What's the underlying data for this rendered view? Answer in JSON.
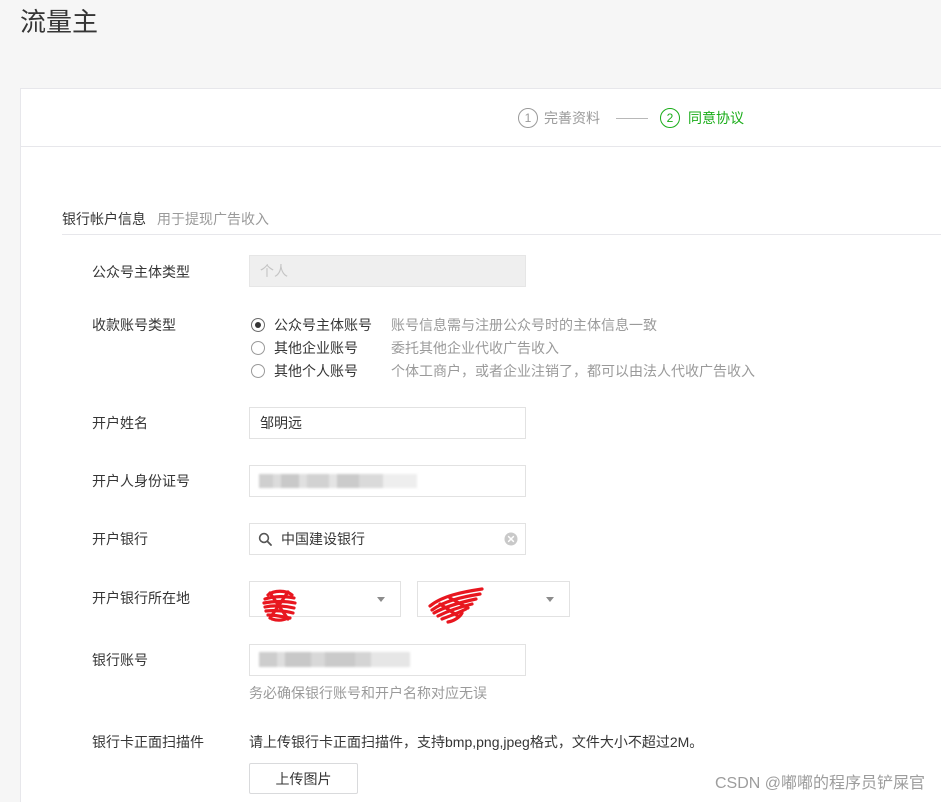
{
  "page": {
    "title": "流量主"
  },
  "steps": [
    {
      "number": "1",
      "label": "完善资料",
      "active": false
    },
    {
      "number": "2",
      "label": "同意协议",
      "active": true
    }
  ],
  "section": {
    "title": "银行帐户信息",
    "subtitle": "用于提现广告收入"
  },
  "form": {
    "subject_type": {
      "label": "公众号主体类型",
      "value": "个人",
      "disabled": true
    },
    "account_type": {
      "label": "收款账号类型",
      "options": [
        {
          "label": "公众号主体账号",
          "desc": "账号信息需与注册公众号时的主体信息一致",
          "selected": true
        },
        {
          "label": "其他企业账号",
          "desc": "委托其他企业代收广告收入",
          "selected": false
        },
        {
          "label": "其他个人账号",
          "desc": "个体工商户，或者企业注销了，都可以由法人代收广告收入",
          "selected": false
        }
      ]
    },
    "holder_name": {
      "label": "开户姓名",
      "value": "邹明远"
    },
    "id_number": {
      "label": "开户人身份证号"
    },
    "bank": {
      "label": "开户银行",
      "value": "中国建设银行"
    },
    "bank_location": {
      "label": "开户银行所在地"
    },
    "account_number": {
      "label": "银行账号",
      "hint": "务必确保银行账号和开户名称对应无误"
    },
    "card_scan": {
      "label": "银行卡正面扫描件",
      "instructions": "请上传银行卡正面扫描件，支持bmp,png,jpeg格式，文件大小不超过2M。",
      "button_label": "上传图片"
    }
  },
  "watermark": "CSDN @嘟嘟的程序员铲屎官",
  "icons": {
    "search": "search-icon",
    "clear": "clear-icon",
    "dropdown": "chevron-down-icon"
  },
  "colors": {
    "accent": "#1aad19",
    "text": "#353535",
    "muted": "#9a9a9a",
    "redaction": "#e8161f"
  }
}
